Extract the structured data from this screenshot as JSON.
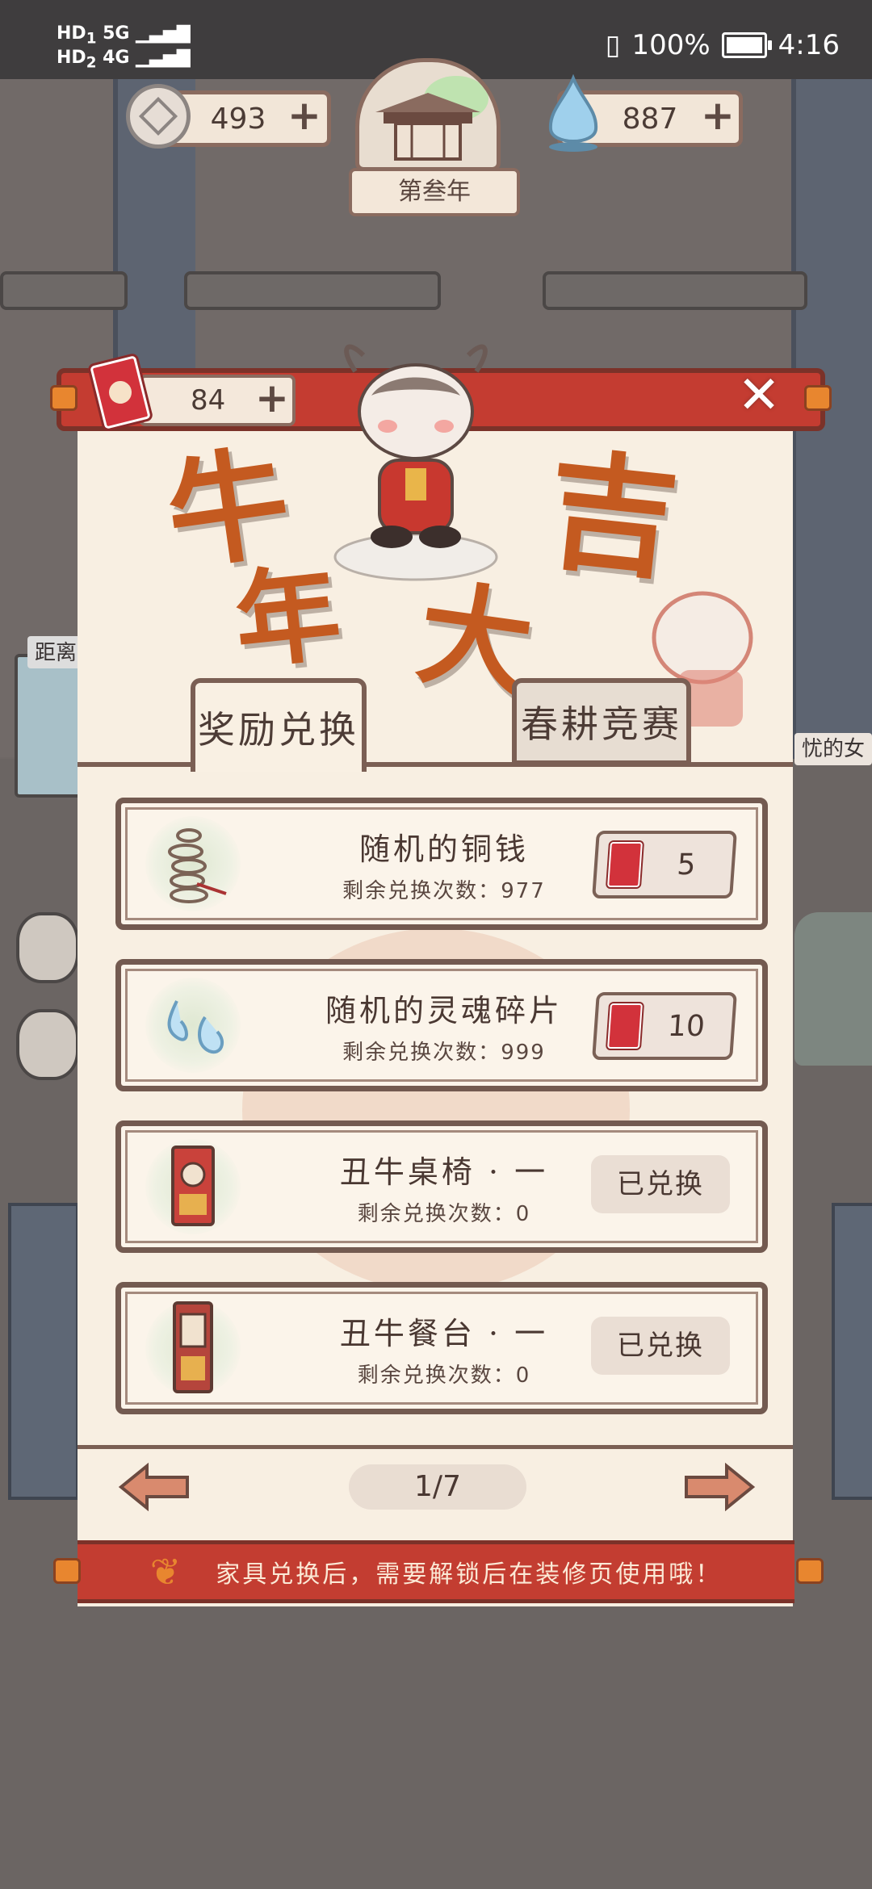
{
  "status_bar": {
    "signal_text": "HD 5G 4G",
    "battery": "100%",
    "time": "4:16"
  },
  "resources": {
    "coins": "493",
    "souls": "887",
    "year": "第叁年"
  },
  "panel": {
    "ticket_count": "84",
    "banner_title": [
      "牛",
      "年",
      "大",
      "吉"
    ],
    "tabs": [
      {
        "label": "奖励兑换",
        "active": true
      },
      {
        "label": "春耕竞赛",
        "active": false
      }
    ],
    "items": [
      {
        "name": "随机的铜钱",
        "remain_label": "剩余兑换次数：",
        "remain": "977",
        "cost": "5",
        "redeemed": false,
        "icon": "copper-coins-icon"
      },
      {
        "name": "随机的灵魂碎片",
        "remain_label": "剩余兑换次数：",
        "remain": "999",
        "cost": "10",
        "redeemed": false,
        "icon": "soul-fragment-icon"
      },
      {
        "name": "丑牛桌椅 · 一",
        "remain_label": "剩余兑换次数：",
        "remain": "0",
        "status": "已兑换",
        "redeemed": true,
        "icon": "ox-table-chair-icon"
      },
      {
        "name": "丑牛餐台 · 一",
        "remain_label": "剩余兑换次数：",
        "remain": "0",
        "status": "已兑换",
        "redeemed": true,
        "icon": "ox-dining-table-icon"
      }
    ],
    "page": "1/7",
    "notice": "家具兑换后，需要解锁后在装修页使用哦！"
  },
  "background": {
    "sign_left": "距离",
    "sign_right": "忧的女"
  },
  "colors": {
    "accent_red": "#c43c31",
    "paper": "#f8efe2",
    "frame_brown": "#735a50"
  }
}
